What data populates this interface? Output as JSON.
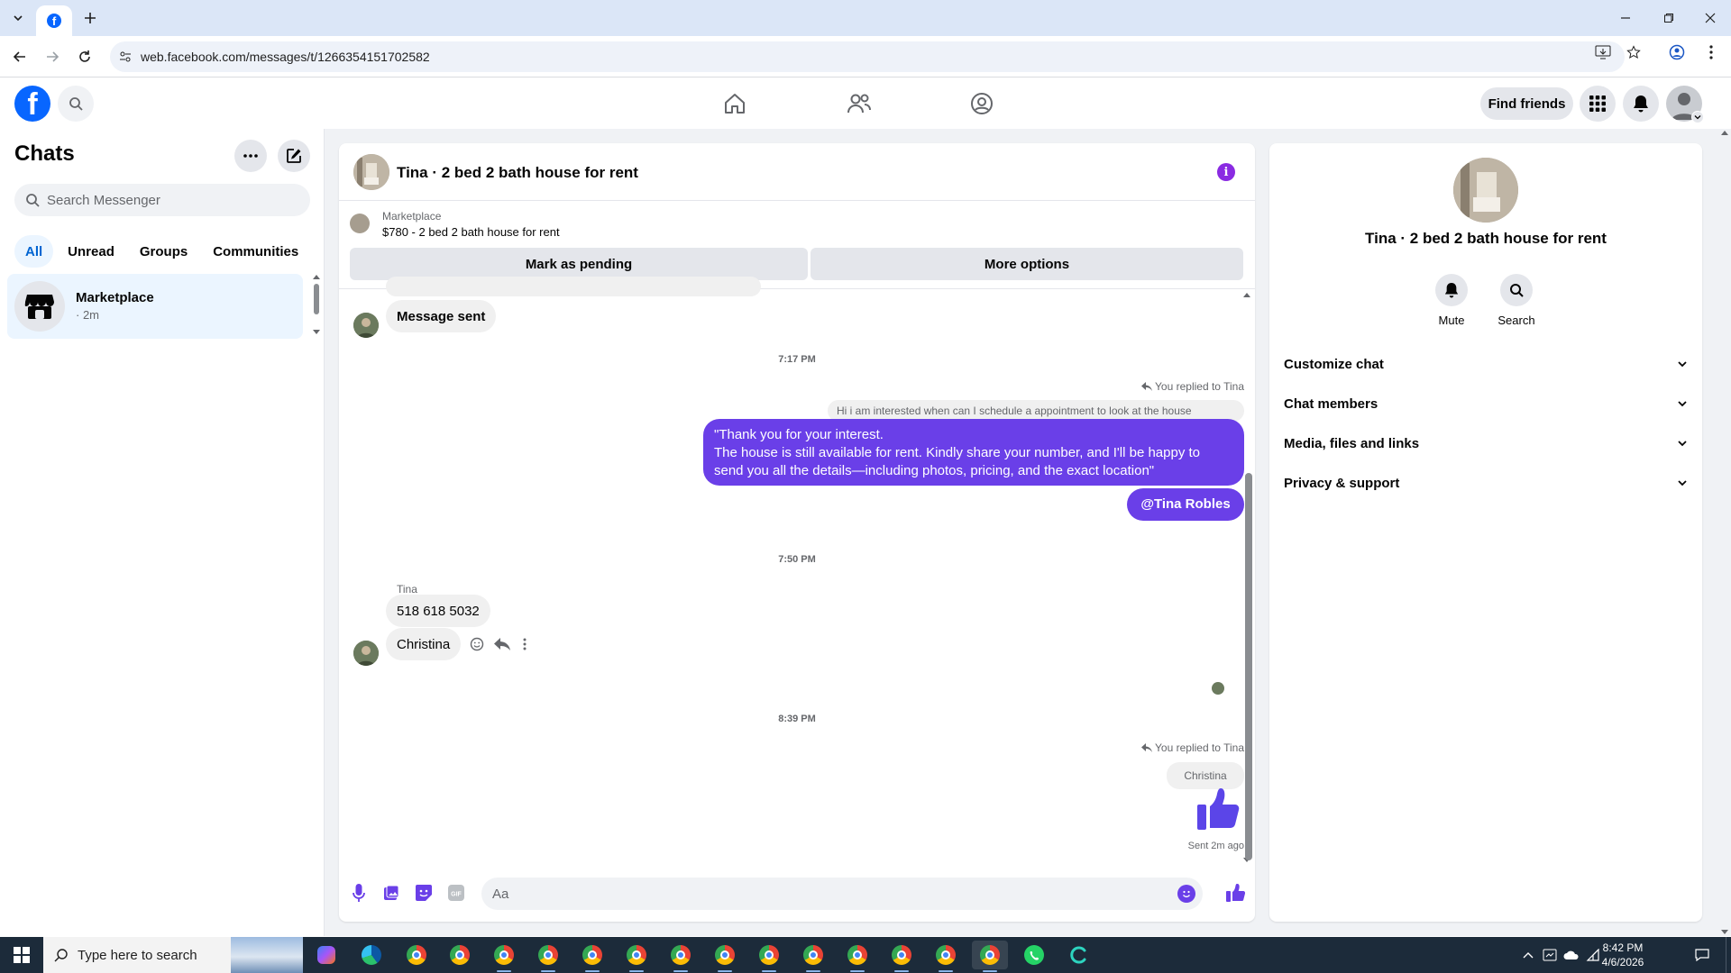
{
  "browser": {
    "url": "web.facebook.com/messages/t/1266354151702582"
  },
  "fb": {
    "find_friends": "Find friends"
  },
  "left": {
    "title": "Chats",
    "search_placeholder": "Search Messenger",
    "tabs": [
      "All",
      "Unread",
      "Groups",
      "Communities"
    ],
    "chat": {
      "name": "Marketplace",
      "time": "· 2m"
    }
  },
  "conversation": {
    "title": "Tina · 2 bed 2 bath house for rent",
    "marketplace_label": "Marketplace",
    "listing": "$780 - 2 bed 2 bath house for rent",
    "mark_pending": "Mark as pending",
    "more_options": "More options",
    "messages": {
      "msg_sent": "Message sent",
      "time1": "7:17 PM",
      "replied1": "You replied to Tina",
      "quoted": "Hi i am interested when can I schedule a appointment to look at the house",
      "reply_line1": "\"Thank you for your interest.",
      "reply_line2": "The house is still available for rent. Kindly share your number, and I'll be happy to",
      "reply_line3": "send you all the details—including photos, pricing, and the exact location\"",
      "mention": "@Tina Robles",
      "time2": "7:50 PM",
      "sender": "Tina",
      "phone": "518 618 5032",
      "christina": "Christina",
      "time3": "8:39 PM",
      "replied2": "You replied to Tina",
      "quoted2": "Christina",
      "sent_status": "Sent 2m ago"
    },
    "composer_placeholder": "Aa"
  },
  "info_panel": {
    "title": "Tina · 2 bed 2 bath house for rent",
    "mute": "Mute",
    "search": "Search",
    "sections": [
      "Customize chat",
      "Chat members",
      "Media, files and links",
      "Privacy & support"
    ]
  },
  "taskbar": {
    "search_placeholder": "Type here to search",
    "time": "8:42 PM",
    "date": "4/6/2026"
  },
  "colors": {
    "fb_blue": "#0866ff",
    "outgoing_bubble": "#6a3fe8",
    "selected_chat": "#ebf5ff"
  }
}
